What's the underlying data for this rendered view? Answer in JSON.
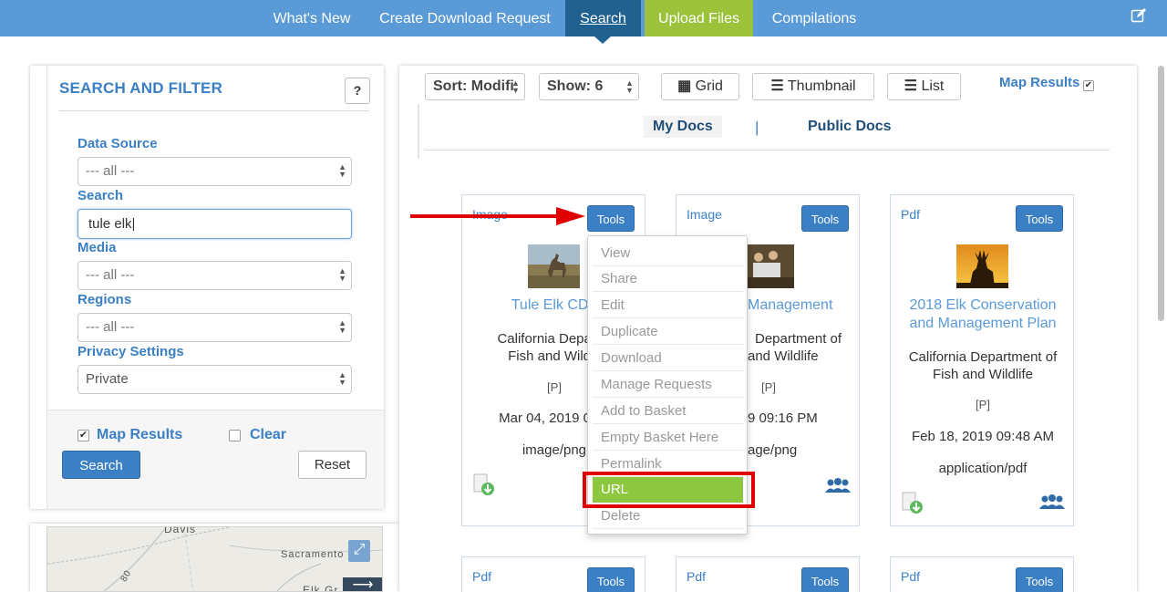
{
  "nav": {
    "items": [
      "What's New",
      "Create Download Request",
      "Search",
      "Upload Files",
      "Compilations"
    ],
    "active": "Search",
    "edit_icon": "edit-icon"
  },
  "filter": {
    "title": "SEARCH AND FILTER",
    "help_label": "?",
    "data_source_label": "Data Source",
    "data_source_value": "--- all ---",
    "search_label": "Search",
    "search_value": "tule elk",
    "media_label": "Media",
    "media_value": "--- all ---",
    "regions_label": "Regions",
    "regions_value": "--- all ---",
    "privacy_label": "Privacy Settings",
    "privacy_value": "Private",
    "map_results_label": "Map Results",
    "map_results_checked": true,
    "clear_label": "Clear",
    "clear_checked": false,
    "search_button": "Search",
    "reset_button": "Reset"
  },
  "map": {
    "labels": [
      "Davis",
      "Sacramento",
      "80",
      "Elk Gr"
    ],
    "expand_icon": "expand-icon",
    "arrow_icon": "arrow-right-icon"
  },
  "toolbar": {
    "sort_value": "Sort: Modifi",
    "show_value": "Show: 6",
    "grid_label": "Grid",
    "thumbnail_label": "Thumbnail",
    "list_label": "List",
    "map_results_label": "Map Results",
    "map_results_checked": true
  },
  "docs_tabs": {
    "mine": "My Docs",
    "separator": "|",
    "public": "Public Docs"
  },
  "cards": [
    {
      "type": "Image",
      "tools": "Tools",
      "title": "Tule Elk CDF",
      "agency_line1": "California Departm",
      "agency_line2": "Fish and Wildlif",
      "privacy": "[P]",
      "date": "Mar 04, 2019 09:2",
      "mime": "image/png"
    },
    {
      "type": "Image",
      "tools": "Tools",
      "title": "Management",
      "agency_line1": "Department of",
      "agency_line2": "and Wildlife",
      "privacy": "[P]",
      "date": "9 09:16 PM",
      "mime": "age/png"
    },
    {
      "type": "Pdf",
      "tools": "Tools",
      "title_line1": "2018 Elk Conservation",
      "title_line2": "and Management Plan",
      "agency_line1": "California Department of",
      "agency_line2": "Fish and Wildlife",
      "privacy": "[P]",
      "date": "Feb 18, 2019 09:48 AM",
      "mime": "application/pdf"
    }
  ],
  "cards_row2": [
    {
      "type": "Pdf",
      "tools": "Tools"
    },
    {
      "type": "Pdf",
      "tools": "Tools"
    },
    {
      "type": "Pdf",
      "tools": "Tools"
    }
  ],
  "tools_menu": {
    "items": [
      "View",
      "Share",
      "Edit",
      "Duplicate",
      "Download",
      "Manage Requests",
      "Add to Basket",
      "Empty Basket Here",
      "Permalink",
      "URL",
      "Delete"
    ],
    "highlighted": "URL"
  },
  "annotation": {
    "arrow_color": "#e10000",
    "box_color": "#e10000"
  },
  "colors": {
    "nav_bg": "#5a9ad6",
    "nav_active": "#21618f",
    "upload_bg": "#9bc23a",
    "accent": "#3b7fc4",
    "menu_highlight": "#8dc63f"
  }
}
